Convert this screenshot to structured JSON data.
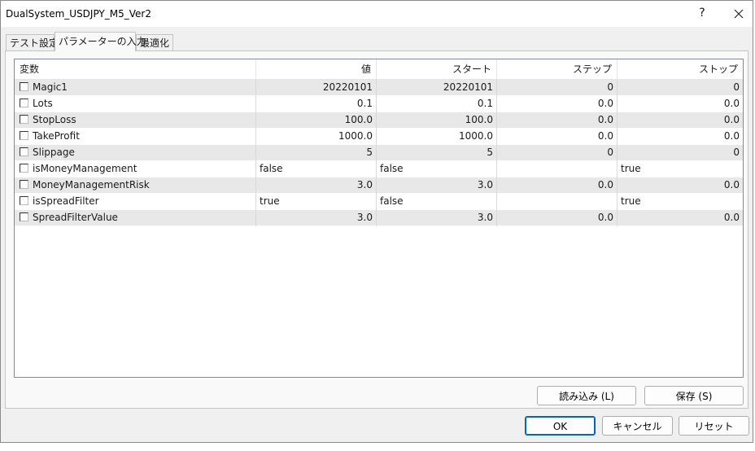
{
  "window": {
    "title": "DualSystem_USDJPY_M5_Ver2",
    "help_glyph": "?",
    "close_glyph": "✕"
  },
  "tabs": [
    {
      "label": "テスト設定"
    },
    {
      "label": "パラメーターの入力"
    },
    {
      "label": "最適化"
    }
  ],
  "active_tab": "パラメーターの入力",
  "table": {
    "columns": [
      "変数",
      "値",
      "スタート",
      "ステップ",
      "ストップ"
    ],
    "rows": [
      {
        "name": "Magic1",
        "value": "20220101",
        "start": "20220101",
        "step": "0",
        "stop": "0",
        "checked": false
      },
      {
        "name": "Lots",
        "value": "0.1",
        "start": "0.1",
        "step": "0.0",
        "stop": "0.0",
        "checked": false
      },
      {
        "name": "StopLoss",
        "value": "100.0",
        "start": "100.0",
        "step": "0.0",
        "stop": "0.0",
        "checked": false
      },
      {
        "name": "TakeProfit",
        "value": "1000.0",
        "start": "1000.0",
        "step": "0.0",
        "stop": "0.0",
        "checked": false
      },
      {
        "name": "Slippage",
        "value": "5",
        "start": "5",
        "step": "0",
        "stop": "0",
        "checked": false
      },
      {
        "name": "isMoneyManagement",
        "value": "false",
        "start": "false",
        "step": "",
        "stop": "true",
        "checked": false
      },
      {
        "name": "MoneyManagementRisk",
        "value": "3.0",
        "start": "3.0",
        "step": "0.0",
        "stop": "0.0",
        "checked": false
      },
      {
        "name": "isSpreadFilter",
        "value": "true",
        "start": "false",
        "step": "",
        "stop": "true",
        "checked": false
      },
      {
        "name": "SpreadFilterValue",
        "value": "3.0",
        "start": "3.0",
        "step": "0.0",
        "stop": "0.0",
        "checked": false
      }
    ]
  },
  "buttons": {
    "load": "読み込み (L)",
    "save": "保存 (S)",
    "ok": "OK",
    "cancel": "キャンセル",
    "reset": "リセット"
  }
}
